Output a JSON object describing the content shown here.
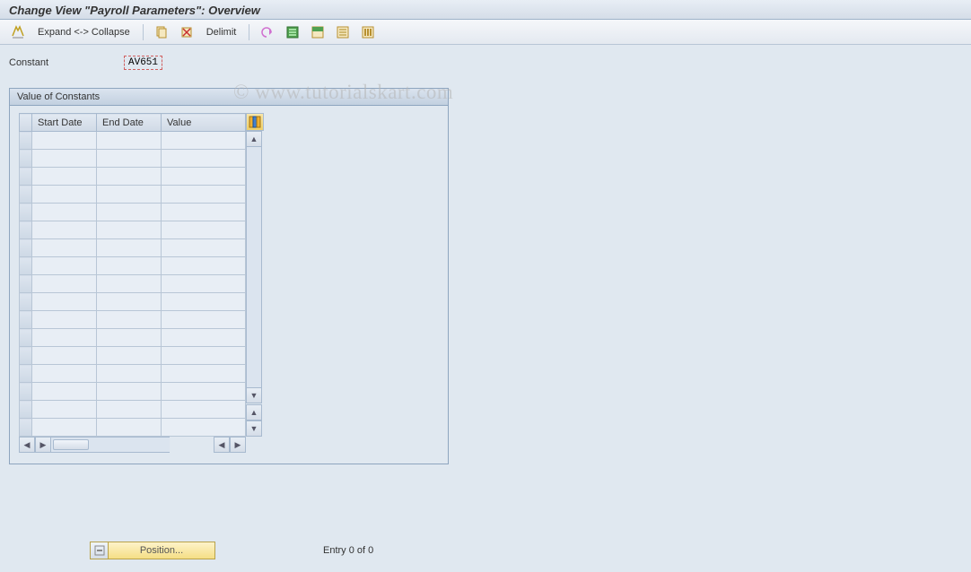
{
  "title": "Change View \"Payroll Parameters\": Overview",
  "toolbar": {
    "expand_collapse": "Expand <-> Collapse",
    "delimit": "Delimit"
  },
  "constant": {
    "label": "Constant",
    "value": "AV651"
  },
  "panel": {
    "title": "Value of Constants",
    "cols": [
      "Start Date",
      "End Date",
      "Value"
    ],
    "rows": [
      {
        "start": "",
        "end": "",
        "value": ""
      },
      {
        "start": "",
        "end": "",
        "value": ""
      },
      {
        "start": "",
        "end": "",
        "value": ""
      },
      {
        "start": "",
        "end": "",
        "value": ""
      },
      {
        "start": "",
        "end": "",
        "value": ""
      },
      {
        "start": "",
        "end": "",
        "value": ""
      },
      {
        "start": "",
        "end": "",
        "value": ""
      },
      {
        "start": "",
        "end": "",
        "value": ""
      },
      {
        "start": "",
        "end": "",
        "value": ""
      },
      {
        "start": "",
        "end": "",
        "value": ""
      },
      {
        "start": "",
        "end": "",
        "value": ""
      },
      {
        "start": "",
        "end": "",
        "value": ""
      },
      {
        "start": "",
        "end": "",
        "value": ""
      },
      {
        "start": "",
        "end": "",
        "value": ""
      },
      {
        "start": "",
        "end": "",
        "value": ""
      },
      {
        "start": "",
        "end": "",
        "value": ""
      },
      {
        "start": "",
        "end": "",
        "value": ""
      }
    ]
  },
  "position_btn": "Position...",
  "entry_status": "Entry 0 of 0",
  "watermark": "© www.tutorialskart.com"
}
